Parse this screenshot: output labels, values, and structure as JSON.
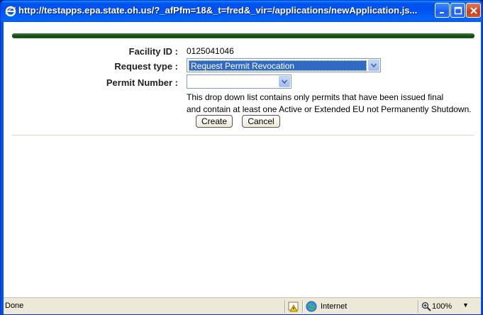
{
  "window": {
    "title": "http://testapps.epa.state.oh.us/?_afPfm=18&_t=fred&_vir=/applications/newApplication.js...",
    "icon": "ie-icon"
  },
  "form": {
    "facility_label": "Facility ID :",
    "facility_value": "0125041046",
    "request_label": "Request type :",
    "request_selected": "Request Permit Revocation",
    "permit_label": "Permit Number :",
    "permit_selected": "",
    "help_line1": "This drop down list contains only permits that have been issued final",
    "help_line2": "and contain at least one Active or Extended EU not Permanently Shutdown.",
    "create_label": "Create",
    "cancel_label": "Cancel"
  },
  "statusbar": {
    "status": "Done",
    "zone": "Internet",
    "zoom": "100%"
  },
  "colors": {
    "titlebar": "#0054e3",
    "accent_bar": "#0d4a0d",
    "selection": "#316ac5"
  }
}
